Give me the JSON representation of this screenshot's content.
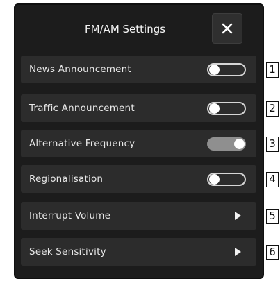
{
  "header": {
    "title": "FM/AM Settings",
    "close_icon": "close-icon"
  },
  "settings": [
    {
      "label": "News Announcement",
      "control": "toggle",
      "state": "off",
      "callout": "1"
    },
    {
      "label": "Traffic Announcement",
      "control": "toggle",
      "state": "off",
      "callout": "2"
    },
    {
      "label": "Alternative Frequency",
      "control": "toggle",
      "state": "on",
      "callout": "3"
    },
    {
      "label": "Regionalisation",
      "control": "toggle",
      "state": "off",
      "callout": "4"
    },
    {
      "label": "Interrupt Volume",
      "control": "arrow",
      "icon": "chevron-right-icon",
      "callout": "5"
    },
    {
      "label": "Seek Sensitivity",
      "control": "arrow",
      "icon": "chevron-right-icon",
      "callout": "6"
    }
  ],
  "colors": {
    "panel_background": "#1c1c1c",
    "row_background": "#2c2c2c",
    "text": "#e8e8e8",
    "toggle_on": "#8f8f8f"
  }
}
